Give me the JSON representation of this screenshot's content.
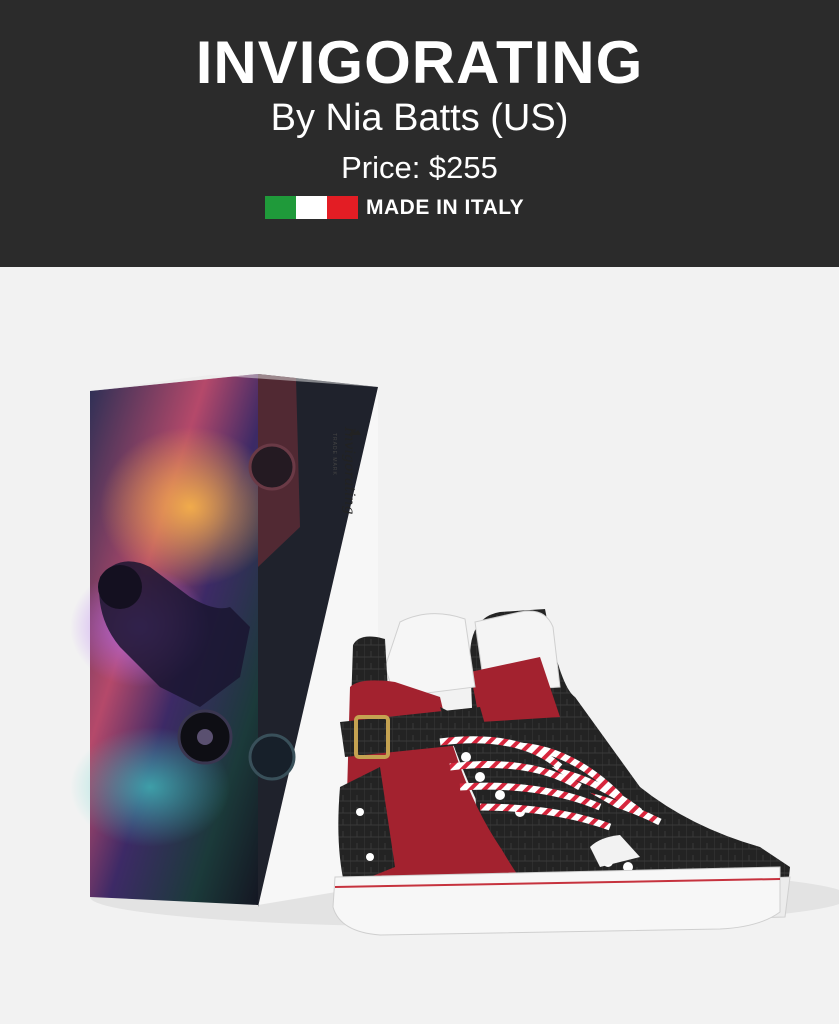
{
  "product": {
    "title": "INVIGORATING",
    "designer": "By Nia Batts (US)",
    "price": "Price: $255",
    "origin_label": "MADE IN ITALY",
    "box_brand": "Invigorating",
    "box_tagline": "TRADE MARK"
  },
  "colors": {
    "header_bg": "#2b2b2b",
    "flag_green": "#1f9a3a",
    "flag_white": "#ffffff",
    "flag_red": "#e31d24",
    "shoe_red": "#a3222f",
    "shoe_black": "#222222"
  },
  "icons": {
    "flag": "italy-flag-icon",
    "crown": "crown-icon"
  }
}
